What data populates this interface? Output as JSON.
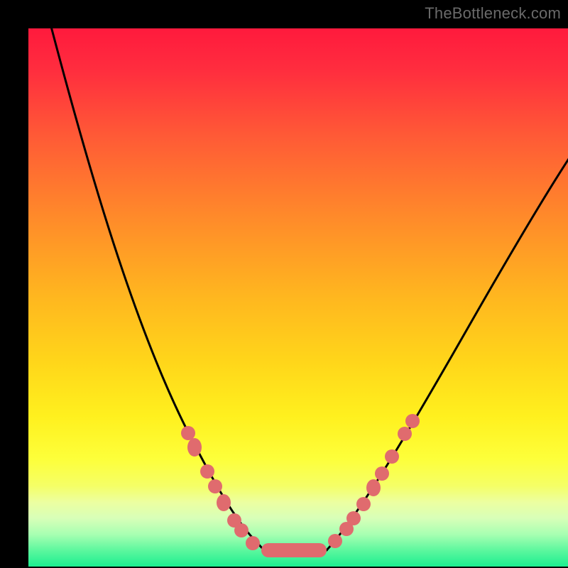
{
  "watermark": "TheBottleneck.com",
  "chart_data": {
    "type": "line",
    "title": "",
    "xlabel": "",
    "ylabel": "",
    "background_gradient": {
      "orientation": "vertical",
      "stops": [
        {
          "pos": 0.0,
          "color": "#ff1a3d"
        },
        {
          "pos": 0.2,
          "color": "#ff5a36"
        },
        {
          "pos": 0.5,
          "color": "#ffb71f"
        },
        {
          "pos": 0.72,
          "color": "#fff01e"
        },
        {
          "pos": 0.88,
          "color": "#ecffa0"
        },
        {
          "pos": 1.0,
          "color": "#1cef90"
        }
      ]
    },
    "series": [
      {
        "name": "bottleneck-curve",
        "color": "#000000",
        "x": [
          0.04,
          0.12,
          0.2,
          0.28,
          0.34,
          0.4,
          0.44,
          0.5,
          0.55,
          0.62,
          0.7,
          0.8,
          0.9,
          1.0
        ],
        "y": [
          1.0,
          0.7,
          0.46,
          0.28,
          0.15,
          0.06,
          0.03,
          0.03,
          0.03,
          0.08,
          0.2,
          0.38,
          0.58,
          0.78
        ]
      }
    ],
    "markers": {
      "name": "highlighted-points",
      "color": "#e06b6e",
      "x": [
        0.3,
        0.31,
        0.33,
        0.35,
        0.36,
        0.38,
        0.4,
        0.42,
        0.45,
        0.5,
        0.55,
        0.57,
        0.59,
        0.6,
        0.62,
        0.64,
        0.66,
        0.68,
        0.7,
        0.71
      ],
      "y": [
        0.25,
        0.22,
        0.18,
        0.15,
        0.12,
        0.09,
        0.07,
        0.04,
        0.03,
        0.03,
        0.03,
        0.05,
        0.07,
        0.09,
        0.12,
        0.15,
        0.18,
        0.21,
        0.25,
        0.27
      ]
    },
    "xlim": [
      0,
      1
    ],
    "ylim": [
      0,
      1
    ],
    "axes_visible": false,
    "grid": false
  }
}
